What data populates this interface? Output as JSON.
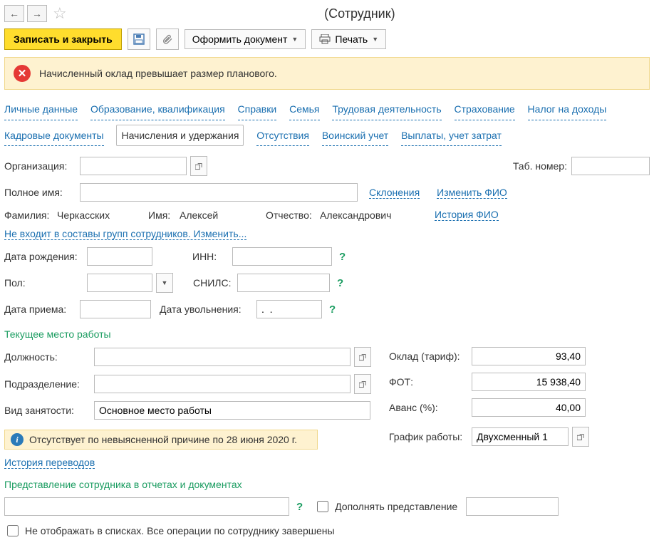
{
  "title": "(Сотрудник)",
  "toolbar": {
    "save_close": "Записать и закрыть",
    "form_doc": "Оформить документ",
    "print": "Печать"
  },
  "alert": {
    "text": "Начисленный оклад превышает размер планового."
  },
  "tabs": {
    "row1": [
      "Личные данные",
      "Образование, квалификация",
      "Справки",
      "Семья",
      "Трудовая деятельность",
      "Страхование",
      "Налог на доходы"
    ],
    "row2": [
      "Кадровые документы",
      "Начисления и удержания",
      "Отсутствия",
      "Воинский учет",
      "Выплаты, учет затрат"
    ],
    "active": "Начисления и удержания"
  },
  "labels": {
    "org": "Организация:",
    "tab_number": "Таб. номер:",
    "full_name": "Полное имя:",
    "lastname": "Фамилия:",
    "firstname": "Имя:",
    "patronymic": "Отчество:",
    "birthdate": "Дата рождения:",
    "inn": "ИНН:",
    "sex": "Пол:",
    "snils": "СНИЛС:",
    "hire_date": "Дата приема:",
    "fire_date": "Дата увольнения:",
    "position": "Должность:",
    "division": "Подразделение:",
    "employment": "Вид занятости:",
    "salary": "Оклад (тариф):",
    "fot": "ФОТ:",
    "advance": "Аванс (%):",
    "schedule": "График работы:",
    "supplement_repr": "Дополнять представление",
    "not_show": "Не отображать в списках. Все операции по сотруднику завершены"
  },
  "links": {
    "declensions": "Склонения",
    "change_fio": "Изменить ФИО",
    "history_fio": "История ФИО",
    "not_in_groups": "Не входит в составы групп сотрудников. Изменить...",
    "transfer_history": "История переводов"
  },
  "values": {
    "lastname": "Черкасских",
    "firstname": "Алексей",
    "patronymic": "Александрович",
    "fire_date": ".  .",
    "employment": "Основное место работы",
    "salary": "93,40",
    "fot": "15 938,40",
    "advance": "40,00",
    "schedule": "Двухсменный 1"
  },
  "headings": {
    "curr_workplace": "Текущее место работы",
    "representation": "Представление сотрудника в отчетах и документах"
  },
  "info": {
    "absence": "Отсутствует по невыясненной причине по 28 июня 2020 г."
  }
}
